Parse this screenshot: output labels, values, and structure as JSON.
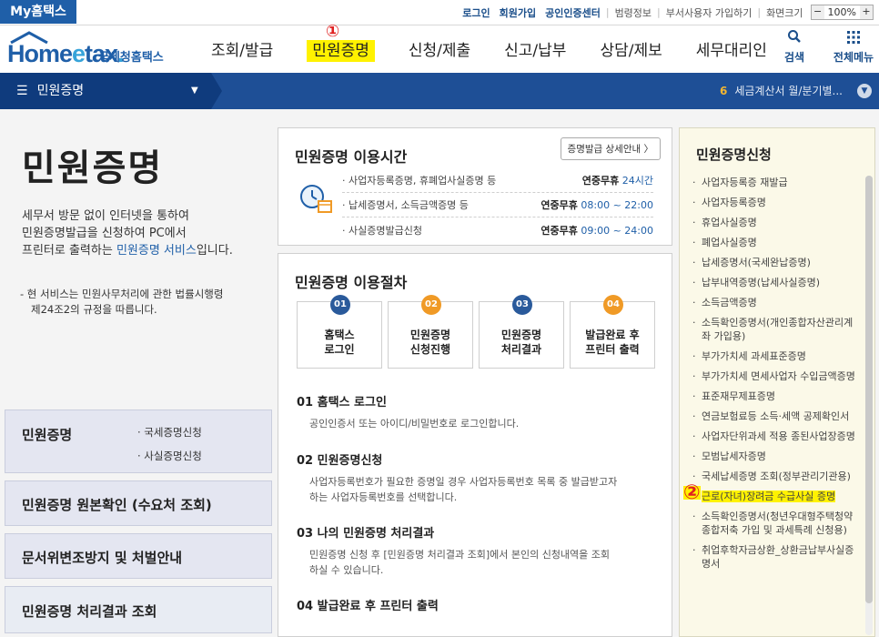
{
  "topbar": {
    "my_tab": "My홈택스",
    "links": [
      "로그인",
      "회원가입",
      "공인인증센터",
      "범령정보",
      "부서사용자 가입하기",
      "화면크기"
    ],
    "zoom_minus": "−",
    "zoom_value": "100%",
    "zoom_plus": "+"
  },
  "header": {
    "logo_home": "Home",
    "logo_e": "e",
    "logo_tax": "tax",
    "logo_dot": ".",
    "logo_sub": "국세청홈택스",
    "nav": [
      "조회/발급",
      "민원증명",
      "신청/제출",
      "신고/납부",
      "상담/제보",
      "세무대리인"
    ],
    "mark1": "①",
    "search_label": "검색",
    "menu_label": "전체메뉴"
  },
  "bluebar": {
    "menu": "민원증명",
    "notice_num": "6",
    "notice_text": "세금계산서 월/분기별..."
  },
  "intro": {
    "title": "민원증명",
    "desc1": "세무서 방문 없이 인터넷을 통하여",
    "desc2": "민원증명발급을 신청하여 PC에서",
    "desc3": "프린터로 출력하는 ",
    "desc3_link": "민원증명 서비스",
    "desc3_end": "입니다.",
    "note1": "- 현 서비스는 민원사무처리에 관한 법률시행령",
    "note2": "제24조2의 규정을 따릅니다."
  },
  "left_boxes": {
    "box1_title": "민원증명",
    "box1_sub1": "· 국세증명신청",
    "box1_sub2": "· 사실증명신청",
    "box2_title": "민원증명 원본확인 (수요처 조회)",
    "box3_title": "문서위변조방지 및 처벌안내",
    "box4_title": "민원증명 처리결과 조회"
  },
  "hours": {
    "title": "민원증명 이용시간",
    "detail_button": "증명발급 상세안내 〉",
    "rows": [
      {
        "name": "· 사업자등록증명, 휴폐업사실증명 등",
        "label": "연중무휴",
        "time": "24시간"
      },
      {
        "name": "· 납세증명서, 소득금액증명 등",
        "label": "연중무휴",
        "time": "08:00 ~ 22:00"
      },
      {
        "name": "· 사실증명발급신청",
        "label": "연중무휴",
        "time": "09:00 ~ 24:00"
      }
    ]
  },
  "procedure": {
    "title": "민원증명 이용절차",
    "steps": [
      {
        "num": "01",
        "line1": "홈택스",
        "line2": "로그인"
      },
      {
        "num": "02",
        "line1": "민원증명",
        "line2": "신청진행"
      },
      {
        "num": "03",
        "line1": "민원증명",
        "line2": "처리결과"
      },
      {
        "num": "04",
        "line1": "발급완료 후",
        "line2": "프린터 출력"
      }
    ],
    "step_colors": [
      "#2a5a9b",
      "#f09a26",
      "#2a5a9b",
      "#f09a26"
    ],
    "items": [
      {
        "head": "01 홈택스 로그인",
        "desc1": "공인인증서 또는 아이디/비밀번호로 로그인합니다.",
        "desc2": ""
      },
      {
        "head": "02 민원증명신청",
        "desc1": "사업자등록번호가 필요한 증명일 경우 사업자등록번호 목록 중 발급받고자",
        "desc2": "하는 사업자등록번호를 선택합니다."
      },
      {
        "head": "03 나의 민원증명 처리결과",
        "desc1": "민원증명 신청 후 [민원증명 처리결과 조회]에서 본인의 신청내역을 조회",
        "desc2": "하실 수 있습니다."
      },
      {
        "head": "04 발급완료 후 프린터 출력",
        "desc1": "",
        "desc2": ""
      }
    ]
  },
  "apply": {
    "title": "민원증명신청",
    "items": [
      "사업자등록증 재발급",
      "사업자등록증명",
      "휴업사실증명",
      "폐업사실증명",
      "납세증명서(국세완납증명)",
      "납부내역증명(납세사실증명)",
      "소득금액증명",
      "소득확인증명서(개인종합자산관리계좌 가입용)",
      "부가가치세 과세표준증명",
      "부가가치세 면세사업자 수입금액증명",
      "표준재무제표증명",
      "연금보험료등 소득·세액 공제확인서",
      "사업자단위과세 적용 종된사업장증명",
      "모범납세자증명",
      "국세납세증명 조회(정부관리기관용)",
      "근로(자녀)장려금 수급사실 증명",
      "소득확인증명서(청년우대형주택청약종합저축 가입 및 과세특례 신청용)",
      "취업후학자금상환_상환금납부사실증명서"
    ],
    "mark2": "②"
  }
}
